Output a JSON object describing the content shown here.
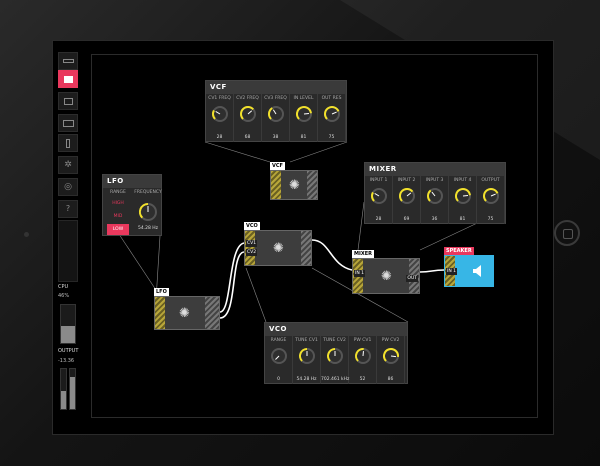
{
  "sidebar": {
    "cpu_label": "CPU",
    "cpu_value": "46%",
    "output_label": "OUTPUT",
    "output_value": "-13.36",
    "cpu_level": 0.46
  },
  "vcf": {
    "title": "VCF",
    "params": [
      {
        "label": "CV1 FREQ",
        "value": "28"
      },
      {
        "label": "CV2 FREQ",
        "value": "68"
      },
      {
        "label": "CV3 FREQ",
        "value": "38"
      },
      {
        "label": "IN LEVEL",
        "value": "81"
      },
      {
        "label": "OUT RES",
        "value": "75"
      }
    ],
    "node_tag": "VCF"
  },
  "mixer": {
    "title": "MIXER",
    "params": [
      {
        "label": "INPUT 1",
        "value": "28"
      },
      {
        "label": "INPUT 2",
        "value": "69"
      },
      {
        "label": "INPUT 3",
        "value": "36"
      },
      {
        "label": "INPUT 4",
        "value": "81"
      },
      {
        "label": "OUTPUT",
        "value": "75"
      }
    ],
    "node_tag": "MIXER",
    "port_in": "IN 1",
    "port_out": "OUT"
  },
  "lfo": {
    "title": "LFO",
    "range_label": "RANGE",
    "frequency_label": "FREQUENCY",
    "buttons": [
      "HIGH",
      "MID",
      "LOW"
    ],
    "frequency_value": "54.28 Hz",
    "node_tag": "LFO"
  },
  "vco": {
    "title": "VCO",
    "params": [
      {
        "label": "RANGE",
        "value": "0"
      },
      {
        "label": "TUNE CV1",
        "value": "54.28 Hz"
      },
      {
        "label": "TUNE CV2",
        "value": "702.461 kHz"
      },
      {
        "label": "PW CV1",
        "value": "52"
      },
      {
        "label": "PW CV2",
        "value": "86"
      }
    ],
    "node_tag": "VCO",
    "port_cv1": "CV1",
    "port_cv2": "CV2"
  },
  "speaker": {
    "tag": "SPEAKER",
    "port_in": "IN 1"
  },
  "colors": {
    "accent": "#e9385d",
    "knob_ring": "#f2e12b",
    "speaker": "#37b6e6"
  },
  "icons": [
    "patch-icon",
    "keyboard-icon",
    "layout-icon",
    "gear-icon",
    "record-icon",
    "help-icon",
    "speaker-icon"
  ]
}
